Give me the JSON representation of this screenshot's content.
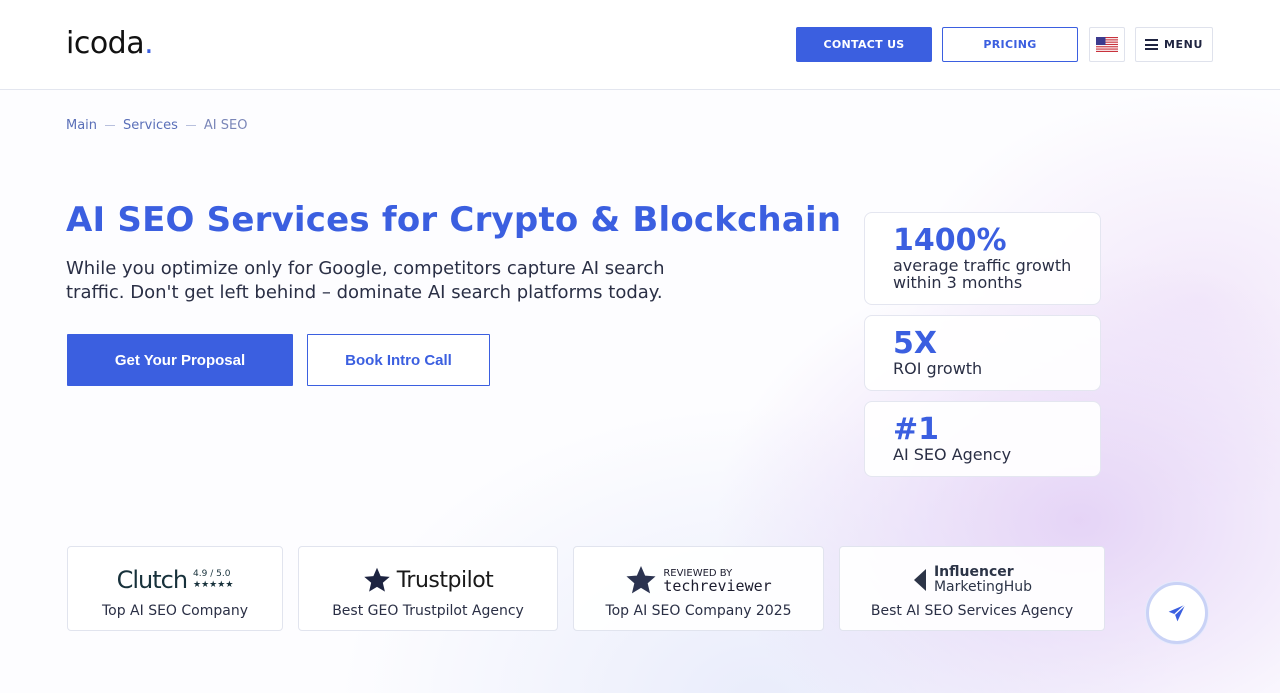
{
  "header": {
    "logo_text": "icoda",
    "logo_dot": ".",
    "contact_label": "CONTACT US",
    "pricing_label": "PRICING",
    "menu_label": "MENU"
  },
  "breadcrumb": {
    "items": [
      "Main",
      "Services",
      "AI SEO"
    ]
  },
  "hero": {
    "title": "AI SEO Services for Crypto & Blockchain",
    "subtitle": "While you optimize only for Google, competitors capture AI search traffic. Don't get left behind – dominate AI search platforms today.",
    "primary_cta": "Get Your Proposal",
    "secondary_cta": "Book Intro Call"
  },
  "stats": [
    {
      "value": "1400%",
      "label": "average traffic growth within 3 months"
    },
    {
      "value": "5X",
      "label": "ROI growth"
    },
    {
      "value": "#1",
      "label": "AI SEO Agency"
    }
  ],
  "awards": [
    {
      "brand": "Clutch",
      "rating": "4.9 / 5.0",
      "stars": "★★★★★",
      "caption": "Top AI SEO Company"
    },
    {
      "brand": "Trustpilot",
      "caption": "Best GEO Trustpilot Agency"
    },
    {
      "brand_small": "REVIEWED BY",
      "brand": "techreviewer",
      "caption": "Top AI SEO Company 2025"
    },
    {
      "brand_line1": "Influencer",
      "brand_line2": "MarketingHub",
      "caption": "Best AI SEO Services Agency"
    }
  ],
  "colors": {
    "accent": "#3b5fe0",
    "text": "#2a2f45"
  },
  "icons": {
    "flag": "us-flag-icon",
    "menu": "hamburger-icon",
    "send": "paper-plane-icon"
  }
}
